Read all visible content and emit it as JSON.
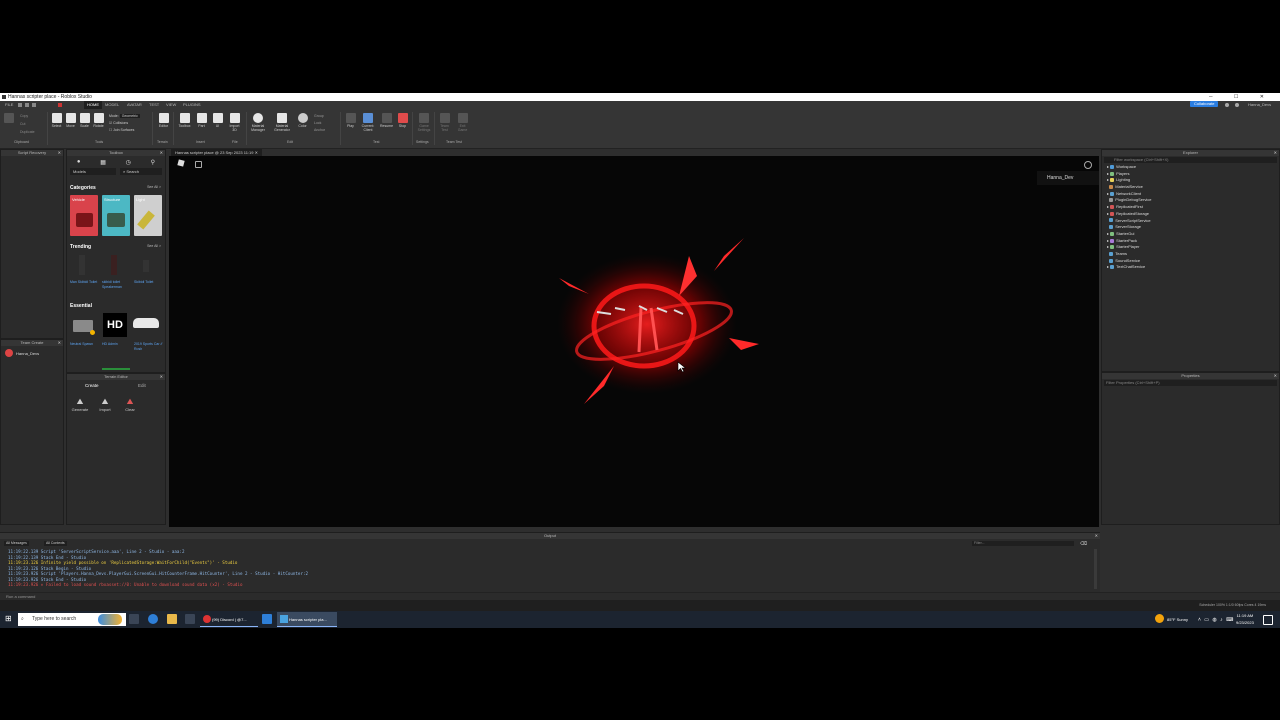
{
  "window": {
    "title": "Hannas scripter place - Roblox Studio",
    "controls": "─ ☐ ✕"
  },
  "menu": {
    "file": "FILE",
    "tabs": [
      "HOME",
      "MODEL",
      "AVATAR",
      "TEST",
      "VIEW",
      "PLUGINS"
    ],
    "collaborate": "Collaborate",
    "user": "Hanna_Devs"
  },
  "ribbon": {
    "clipboard_items": [
      "Paste",
      "Copy",
      "Cut",
      "Duplicate"
    ],
    "tools": [
      "Select",
      "Move",
      "Scale",
      "Rotate"
    ],
    "mode_label": "Mode:",
    "mode_value": "Geometric",
    "collisions": "Collisions",
    "join_surfaces": "Join Surfaces",
    "terrain": [
      "Editor"
    ],
    "insert": [
      "Toolbox",
      "Part",
      "UI",
      "Import 3D"
    ],
    "file": [
      "Material Manager",
      "Material Generator",
      "Color"
    ],
    "edit_group": [
      "Group",
      "Lock",
      "Anchor"
    ],
    "test": [
      "Play",
      "Current: Client",
      "Resume",
      "Stop"
    ],
    "settings": [
      "Game Settings"
    ],
    "team_test": [
      "Team Test",
      "Exit Game"
    ],
    "groups": [
      "Clipboard",
      "Tools",
      "Terrain",
      "Insert",
      "File",
      "Edit",
      "Test",
      "Settings",
      "Team Test"
    ]
  },
  "panels": {
    "script_recovery": "Script Recovery",
    "toolbox": "Toolbox",
    "team_create": "Team Create",
    "terrain_editor": "Terrain Editor",
    "explorer": "Explorer",
    "properties": "Properties",
    "output": "Output"
  },
  "toolbox": {
    "category_select": "Models",
    "search_placeholder": "Search",
    "categories_title": "Categories",
    "trending_title": "Trending",
    "essential_title": "Essential",
    "see_all": "See All >",
    "categories": [
      {
        "label": "Vehicle",
        "color": "#d9434b"
      },
      {
        "label": "Structure",
        "color": "#4cb8c4"
      },
      {
        "label": "Light",
        "color": "#cfcfcf"
      }
    ],
    "trending": [
      "Man Skibidi Toilet",
      "skibidi toilet Speakerman",
      "Skibidi Toilet"
    ],
    "essential": [
      "Neutral Spawn",
      "HD Admin",
      "2019 Sports Car // Rosh"
    ],
    "essential_logo": "HD"
  },
  "team_create": {
    "user": "Hanna_Devs"
  },
  "terrain": {
    "tabs": [
      "Create",
      "Edit"
    ],
    "tools": [
      "Generate",
      "Import",
      "Clear"
    ]
  },
  "viewport": {
    "doc_tab": "Hannas scripter place @ 23 Sep 2023 11:19",
    "player_tag": "Hanna_Dev"
  },
  "explorer": {
    "filter": "Filter workspace (Ctrl+Shift+X)",
    "items": [
      "Workspace",
      "Players",
      "Lighting",
      "MaterialService",
      "NetworkClient",
      "PluginDebugService",
      "ReplicatedFirst",
      "ReplicatedStorage",
      "ServerScriptService",
      "ServerStorage",
      "StarterGui",
      "StarterPack",
      "StarterPlayer",
      "Teams",
      "SoundService",
      "TextChatService"
    ]
  },
  "properties": {
    "filter": "Filter Properties (Ctrl+Shift+P)"
  },
  "output": {
    "filters": [
      "All Messages",
      "All Contexts"
    ],
    "filter_placeholder": "Filter...",
    "lines": [
      {
        "text": "11:19:22.139  Script 'ServerScriptService.aaa', Line 2  -  Studio - aaa:2",
        "color": "#8fb8e6"
      },
      {
        "text": "11:19:22.139  Stack End  -  Studio",
        "color": "#8fb8e6"
      },
      {
        "text": "11:19:23.126  Infinite yield possible on 'ReplicatedStorage:WaitForChild(\"Events\")'  -  Studio",
        "color": "#f0d040"
      },
      {
        "text": "11:19:23.126  Stack Begin  -  Studio",
        "color": "#8fb8e6"
      },
      {
        "text": "11:19:23.926  Script 'Players.Hanna_Devs.PlayerGui.ScreenGui.HitCounterFrame.HitCounter', Line 2  -  Studio - HitCounter:2",
        "color": "#8fb8e6"
      },
      {
        "text": "11:19:23.926  Stack End  -  Studio",
        "color": "#8fb8e6"
      },
      {
        "text": "11:19:23.926  ✕ Failed to load sound rbxasset://0: Unable to download sound data (x2)  -  Studio",
        "color": "#e05050"
      }
    ]
  },
  "command": {
    "placeholder": "Run a command"
  },
  "status": {
    "right": "Scheduler 100%   1:1/0   60fps   Cores 4   19ms"
  },
  "taskbar": {
    "search": "Type here to search",
    "apps": [
      "(99) Discord | @7...",
      "Hannas scripter pla..."
    ],
    "weather": "85°F  Sunny",
    "time": "11:19 AM",
    "date": "9/23/2023"
  }
}
